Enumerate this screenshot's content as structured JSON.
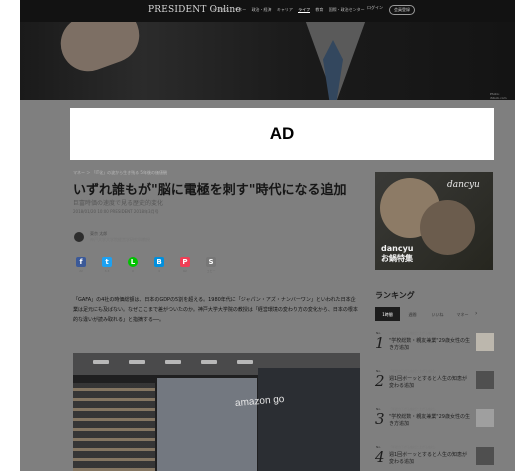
{
  "site": {
    "brand": "PRESIDENT Online",
    "nav": [
      "ビジネス",
      "マネー",
      "政治・経済",
      "キャリア",
      "ライフ",
      "教育",
      "国際・政治センター"
    ],
    "active_nav_index": 4,
    "login": "ログイン",
    "signup": "会員登録"
  },
  "hero": {
    "caption": "Photo: iStock.com"
  },
  "ad": {
    "label": "AD"
  },
  "article": {
    "breadcrumb": "マネー ＞ 「IT化」の波から生き残る 5年後の価値観",
    "headline": "いずれ誰もが\"脳に電極を刺す\"時代になる追加",
    "subhead": "巨富時価の速度で見る歴史的変化",
    "meta": "2018/01/20 10:00 PRESIDENT 2018年3月号",
    "author_name": "東京 太郎",
    "author_note": "神戸大学大学院経営学研究科教授",
    "share": [
      {
        "label": "f",
        "count": "22"
      },
      {
        "label": "t",
        "count": "3.3"
      },
      {
        "label": "L",
        "count": "0"
      },
      {
        "label": "B",
        "count": "4"
      },
      {
        "label": "P",
        "count": "62"
      },
      {
        "label": "S",
        "count": "コピー"
      }
    ],
    "lead": "「GAFA」の4社の時価総額は、日本のGDPの5割を超える。1980年代に「ジャパン・アズ・ナンバーワン」といわれた日本企業は足元にも及ばない。なぜここまで差がついたのか。神戸大学大学院の教授は「経営環境の変わり方の変化から、日本の根本的な違いが読み取れる」と指摘する──。",
    "photo_sign": "amazon go"
  },
  "promo": {
    "brand": "dancyu",
    "title_line1": "dancyu",
    "title_line2": "お鍋特集"
  },
  "ranking": {
    "title": "ランキング",
    "tabs": [
      "1時間",
      "週間",
      "いいね",
      "マネー"
    ],
    "active_tab_index": 0,
    "next_label": "›",
    "items": [
      {
        "no": "No.",
        "rank": "1",
        "kicker": "「年収の下がる会社と上がる会社」",
        "text": "\"学校総数・親友兼業\"29歳女性の生き方追加"
      },
      {
        "no": "No.",
        "rank": "2",
        "kicker": "「年収の下がる会社と上がる会社」",
        "text": "週1回ボーッとすると人生の知恵が変わる追加"
      },
      {
        "no": "No.",
        "rank": "3",
        "kicker": "「年収の下がる会社と上がる会社」",
        "text": "\"学校総数・親友兼業\"29歳女性の生き方追加"
      },
      {
        "no": "No.",
        "rank": "4",
        "kicker": "「年収の下がる会社と上がる会社」",
        "text": "週1回ボーッとすると人生の知恵が変わる追加"
      }
    ]
  },
  "colors": {
    "overlay": "#7f7f7f",
    "topbar": "#121212",
    "ad_bg": "#ffffff",
    "facebook": "#3b5998",
    "twitter": "#1da1f2",
    "line": "#00c300",
    "hatena": "#008fde",
    "pocket": "#ef3f56"
  }
}
